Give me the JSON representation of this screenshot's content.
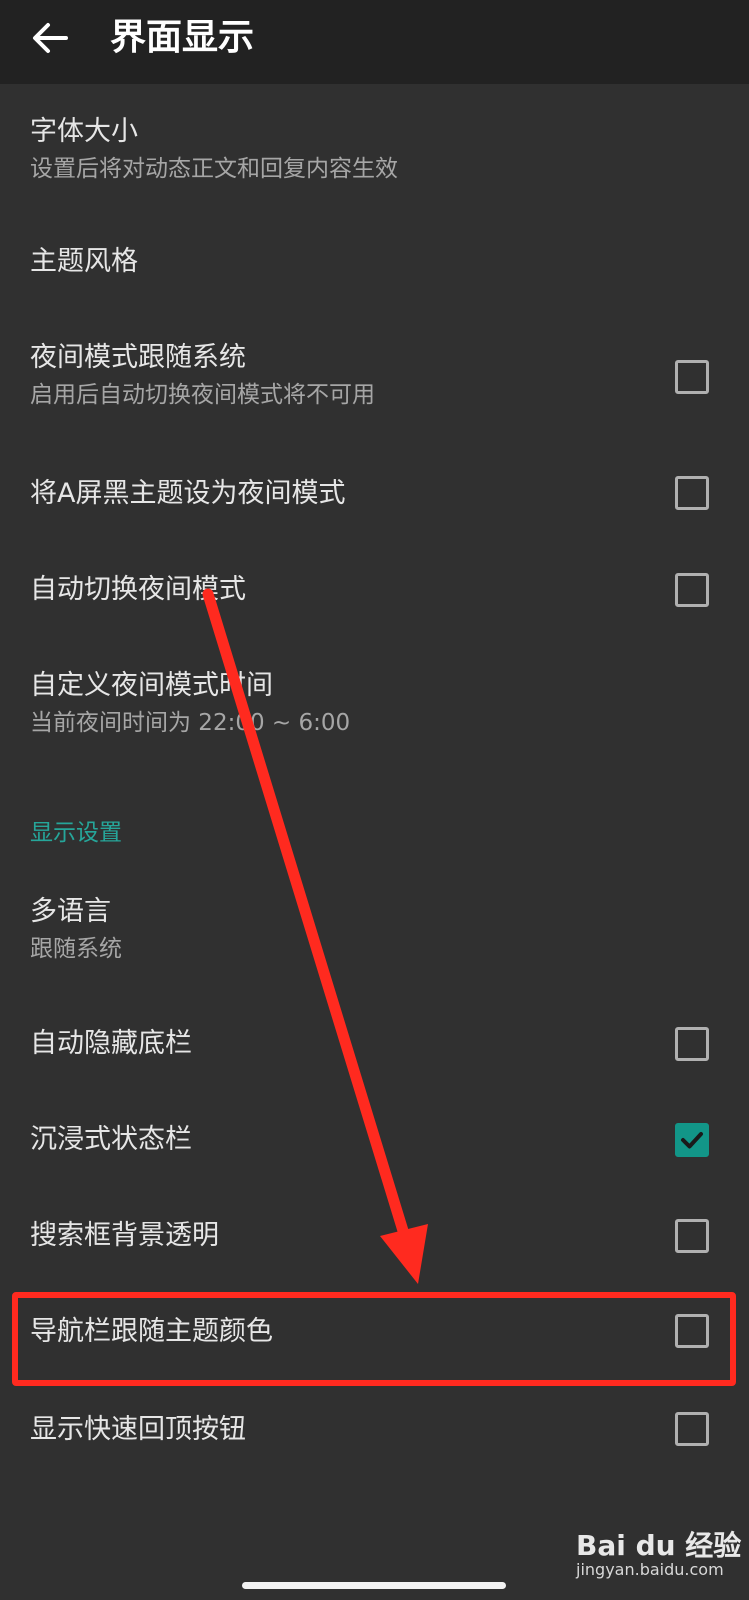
{
  "header": {
    "title": "界面显示",
    "back_icon": "arrow-left-icon"
  },
  "items": [
    {
      "title": "字体大小",
      "subtitle": "设置后将对动态正文和回复内容生效"
    },
    {
      "title": "主题风格"
    },
    {
      "title": "夜间模式跟随系统",
      "subtitle": "启用后自动切换夜间模式将不可用",
      "checked": false
    },
    {
      "title": "将A屏黑主题设为夜间模式",
      "checked": false
    },
    {
      "title": "自动切换夜间模式",
      "checked": false
    },
    {
      "title": "自定义夜间模式时间",
      "subtitle": "当前夜间时间为 22:00 ~ 6:00"
    }
  ],
  "display_section": {
    "header": "显示设置",
    "items": [
      {
        "title": "多语言",
        "subtitle": "跟随系统"
      },
      {
        "title": "自动隐藏底栏",
        "checked": false
      },
      {
        "title": "沉浸式状态栏",
        "checked": true
      },
      {
        "title": "搜索框背景透明",
        "checked": false
      },
      {
        "title": "导航栏跟随主题颜色",
        "checked": false
      },
      {
        "title": "显示快速回顶按钮",
        "checked": false
      }
    ]
  },
  "watermark": {
    "brand": "Bai du 经验",
    "url": "jingyan.baidu.com"
  },
  "colors": {
    "background": "#303030",
    "app_bar": "#222222",
    "accent": "#129688",
    "section_header": "#26a69a",
    "annotation": "#ff2a1f"
  }
}
